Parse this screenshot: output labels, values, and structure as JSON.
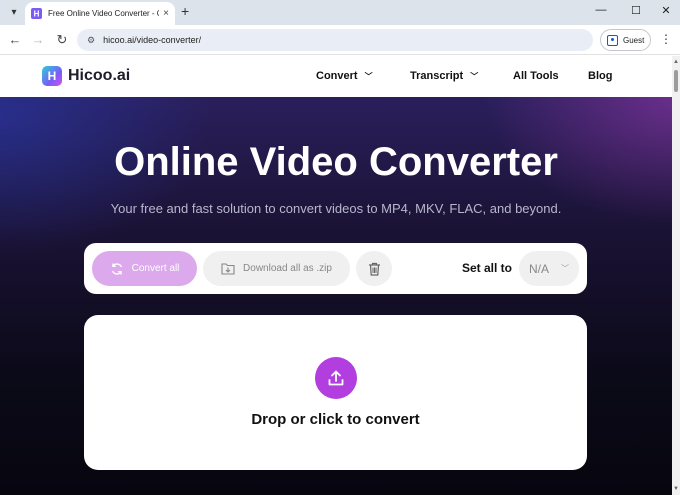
{
  "browser": {
    "tab_title": "Free Online Video Converter - C",
    "url": "hicoo.ai/video-converter/",
    "profile_label": "Guest",
    "new_tab_glyph": "+",
    "close_glyph": "×",
    "window_minimize": "—",
    "window_maximize": "☐",
    "window_close": "✕"
  },
  "site": {
    "logo_text": "Hicoo.ai",
    "logo_glyph": "H",
    "nav": [
      {
        "label": "Convert",
        "has_dropdown": true
      },
      {
        "label": "Transcript",
        "has_dropdown": true
      },
      {
        "label": "All Tools",
        "has_dropdown": false
      },
      {
        "label": "Blog",
        "has_dropdown": false
      }
    ]
  },
  "hero": {
    "title": "Online Video Converter",
    "subtitle": "Your free and fast solution to convert videos to MP4, MKV, FLAC, and beyond."
  },
  "toolbar": {
    "convert_all_label": "Convert all",
    "download_zip_label": "Download all as .zip",
    "set_all_label": "Set all to",
    "format_value": "N/A"
  },
  "dropzone": {
    "label": "Drop or click to convert"
  },
  "colors": {
    "accent": "#b23ee0",
    "convert_button": "#dba9ec"
  },
  "icons": {
    "convert": "refresh-icon",
    "download": "folder-download-icon",
    "delete": "trash-icon",
    "upload": "upload-icon"
  }
}
